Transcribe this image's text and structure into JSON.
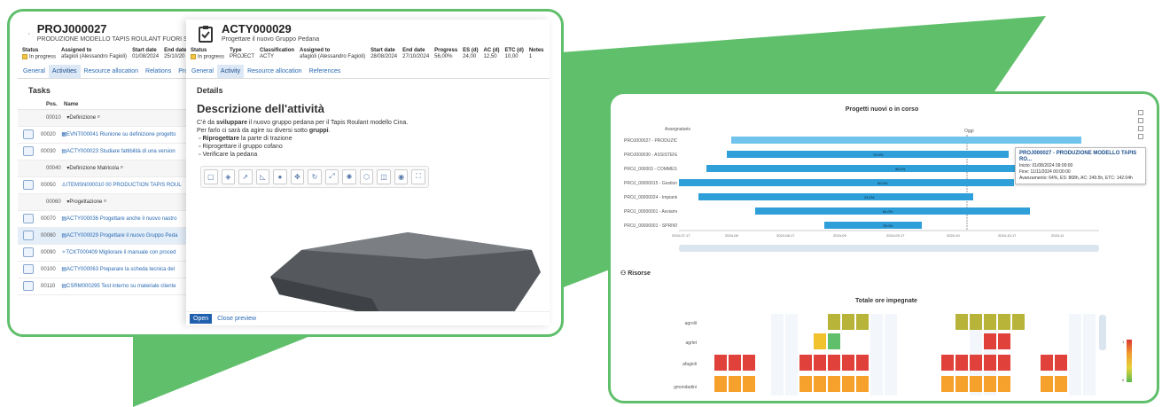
{
  "project_window": {
    "code": "PROJ000027",
    "subtitle": "PRODUZIONE MODELLO TAPIS ROULANT FUORI ST",
    "meta_headers": [
      "Status",
      "Assigned to",
      "Start date",
      "End date"
    ],
    "meta_values": [
      "In progress",
      "afagioli (Alessandro Fagioli)",
      "01/08/2024",
      "25/10/20"
    ],
    "tabs": [
      "General",
      "Activities",
      "Resource allocation",
      "Relations",
      "Pro"
    ],
    "active_tab": "Activities",
    "tasks_title": "Tasks",
    "grid_headers": [
      "Pos.",
      "Name"
    ],
    "rows": [
      {
        "type": "group",
        "pos": "00010",
        "name": "Definizione"
      },
      {
        "type": "item",
        "pos": "00020",
        "name": "EVNT000041 Riunione su definizione progetto"
      },
      {
        "type": "item",
        "pos": "00030",
        "name": "ACTY000023 Studiare fattibilità di una version"
      },
      {
        "type": "group",
        "pos": "00040",
        "name": "Definizione Matricola"
      },
      {
        "type": "item",
        "pos": "00050",
        "name": "ITEMSN000010 00 PRODUCTION TAPIS ROUL"
      },
      {
        "type": "group",
        "pos": "00060",
        "name": "Progettazione"
      },
      {
        "type": "item",
        "pos": "00070",
        "name": "ACTY000036 Progettare anche il nuovo nastro"
      },
      {
        "type": "selected",
        "pos": "00080",
        "name": "ACTY000029 Progettare il nuovo Gruppo Peda"
      },
      {
        "type": "item",
        "pos": "00090",
        "name": "TCKT000409 Migliorare il manuale con proced"
      },
      {
        "type": "item",
        "pos": "00100",
        "name": "ACTY000063 Preparare la scheda tecnica del"
      },
      {
        "type": "item",
        "pos": "00110",
        "name": "CSRM000295 Test interno su materiale cliente"
      }
    ]
  },
  "activity_window": {
    "code": "ACTY000029",
    "subtitle": "Progettare il nuovo Gruppo Pedana",
    "meta_headers": [
      "Status",
      "Type",
      "Classification",
      "Assigned to",
      "Start date",
      "End date",
      "Progress",
      "ES (d)",
      "AC (d)",
      "ETC (d)",
      "Notes"
    ],
    "meta_values": [
      "In progress",
      "PROJECT",
      "ACTY",
      "afagioli (Alessandro Fagioli)",
      "28/08/2024",
      "27/10/2024",
      "56,00%",
      "24,00",
      "12,50",
      "10,00",
      "1"
    ],
    "tabs": [
      "General",
      "Activity",
      "Resource allocation",
      "References"
    ],
    "active_tab": "Activity",
    "details_title": "Details",
    "description_title": "Descrizione dell'attività",
    "desc_line1_pre": "C'è da ",
    "desc_line1_bold": "sviluppare",
    "desc_line1_post": " il nuovo gruppo pedana per il Tapis Roulant modello Cina.",
    "desc_line2_pre": "Per farlo ci sarà da agire su diversi sotto ",
    "desc_line2_bold": "gruppi",
    "desc_line2_post": ".",
    "bullets": [
      {
        "bold": "Riprogettare",
        "rest": " la parte di trazione"
      },
      {
        "bold": "",
        "rest": "Riprogettare il gruppo cofano"
      },
      {
        "bold": "",
        "rest": "Verificare la pedana"
      }
    ],
    "toolbar_icons": [
      "file-icon",
      "layers-icon",
      "cursor-icon",
      "ruler-icon",
      "comment-icon",
      "move-icon",
      "rotate-icon",
      "expand-icon",
      "explode-icon",
      "cube-icon",
      "section-icon",
      "camera-icon",
      "fullscreen-icon"
    ],
    "open_label": "Open",
    "preview_label": "Close preview"
  },
  "dashboard": {
    "gantt_title": "Progetti nuovi o in corso",
    "assignee_header": "Assegnatario",
    "today_label": "Oggi",
    "gantt_rows": [
      {
        "label": "PROJ000027 - PRODUZIONE...",
        "pct": ""
      },
      {
        "label": "PROJ000030 - ASSISTENZA E...",
        "pct": "70.0%"
      },
      {
        "label": "PROJ_000003 - COMMESSA...",
        "pct": "98.0%"
      },
      {
        "label": "PROJ_00000015 - Gestione n...",
        "pct": "50.0%"
      },
      {
        "label": "PROJ_00000024 - Impianto p...",
        "pct": "24.0%"
      },
      {
        "label": "PROJ_00000001 - Avviament...",
        "pct": "64.0%"
      },
      {
        "label": "PROJ_00000001 - SPRINT 20...",
        "pct": "78.0%"
      }
    ],
    "gantt_dates": [
      "2024-07-17",
      "2024-08",
      "2024-08-17",
      "2024-09",
      "2024-09-17",
      "2024-10",
      "2024-10-17",
      "2024-11"
    ],
    "tooltip": {
      "title": "PROJ000027 - PRODUZIONE MODELLO TAPIS RO...",
      "start": "Inizio: 01/08/2024 09:00:00",
      "end": "Fine: 11/11/2024 00:00:00",
      "progress": "Avanzamento: 64%, ES: 868h, AC: 249.5h, ETC: 142.04h"
    },
    "resources_title": "Risorse",
    "heatmap_title": "Totale ore impegnate",
    "heatmap_rows": [
      "agrolil",
      "agrlet",
      "afagioli",
      "gmondadini"
    ],
    "legend_top": "1",
    "legend_bottom": "0",
    "colors": {
      "green": "#5fbf6b",
      "blue": "#2e9fd8",
      "red": "#e0413a",
      "orange": "#f5a12b",
      "olive": "#b8b43a",
      "yellow": "#f2c12e",
      "link": "#2a6ab3"
    }
  }
}
